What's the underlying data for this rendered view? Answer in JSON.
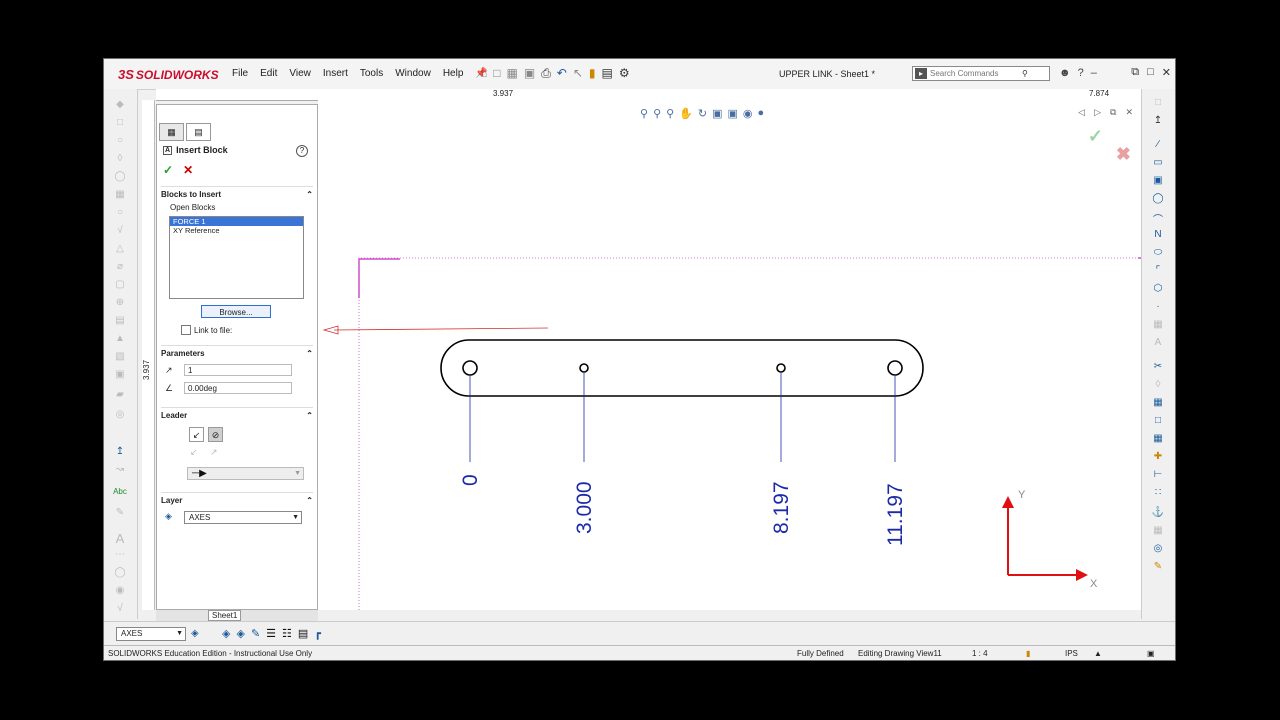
{
  "app": {
    "logo_ds": "3S",
    "logo_text": "SOLIDWORKS",
    "document_title": "UPPER LINK - Sheet1 *"
  },
  "menu": [
    "File",
    "Edit",
    "View",
    "Insert",
    "Tools",
    "Window",
    "Help"
  ],
  "search": {
    "placeholder": "Search Commands"
  },
  "ruler": {
    "top_mid": "3.937",
    "top_right": "7.874",
    "left_mid": "3.937"
  },
  "property_manager": {
    "title": "Insert Block",
    "sections": {
      "blocks_to_insert": "Blocks to Insert",
      "open_blocks_label": "Open Blocks",
      "open_blocks": [
        "FORCE 1",
        "XY Reference"
      ],
      "selected_block": "FORCE 1",
      "browse_button": "Browse...",
      "link_to_file": "Link to file:",
      "parameters": "Parameters",
      "scale_value": "1",
      "angle_value": "0.00deg",
      "leader": "Leader",
      "layer": "Layer",
      "layer_value": "AXES"
    }
  },
  "sheet_tab": "Sheet1",
  "drawing": {
    "dimensions": [
      "0",
      "3.000",
      "8.197",
      "11.197"
    ],
    "axis_x": "X",
    "axis_y": "Y"
  },
  "bottom": {
    "layer_value": "AXES"
  },
  "status": {
    "edition": "SOLIDWORKS Education Edition - Instructional Use Only",
    "defined": "Fully Defined",
    "editing": "Editing Drawing View11",
    "scale": "1 : 4",
    "units": "IPS"
  },
  "colors": {
    "accent": "#c8102e",
    "dimension": "#1a2aa8",
    "frame": "#d24bcf",
    "axis": "#e01010"
  }
}
